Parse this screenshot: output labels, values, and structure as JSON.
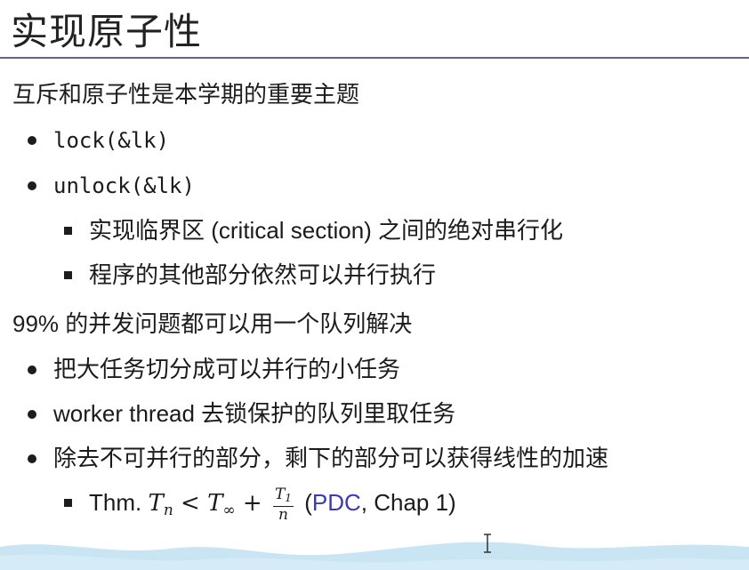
{
  "slide": {
    "title": "实现原子性",
    "section1": {
      "heading": "互斥和原子性是本学期的重要主题",
      "items": [
        {
          "label": "lock(&lk)"
        },
        {
          "label": "unlock(&lk)",
          "subitems": [
            "实现临界区 (critical section) 之间的绝对串行化",
            "程序的其他部分依然可以并行执行"
          ]
        }
      ]
    },
    "section2": {
      "heading": "99% 的并发问题都可以用一个队列解决",
      "items": [
        "把大任务切分成可以并行的小任务",
        "worker thread 去锁保护的队列里取任务",
        "除去不可并行的部分，剩下的部分可以获得线性的加速"
      ],
      "theorem": {
        "prefix": "Thm.",
        "T": "T",
        "sub_n": "n",
        "lt": "<",
        "sub_inf": "∞",
        "plus": "+",
        "frac_num_T": "T",
        "frac_num_sub": "1",
        "frac_den": "n",
        "open": "(",
        "link_text": "PDC",
        "ref_text": ", Chap 1)"
      }
    }
  },
  "colors": {
    "rule": "#6b5f8a",
    "link": "#3b3bb0",
    "wave": "#bfe0f2"
  }
}
